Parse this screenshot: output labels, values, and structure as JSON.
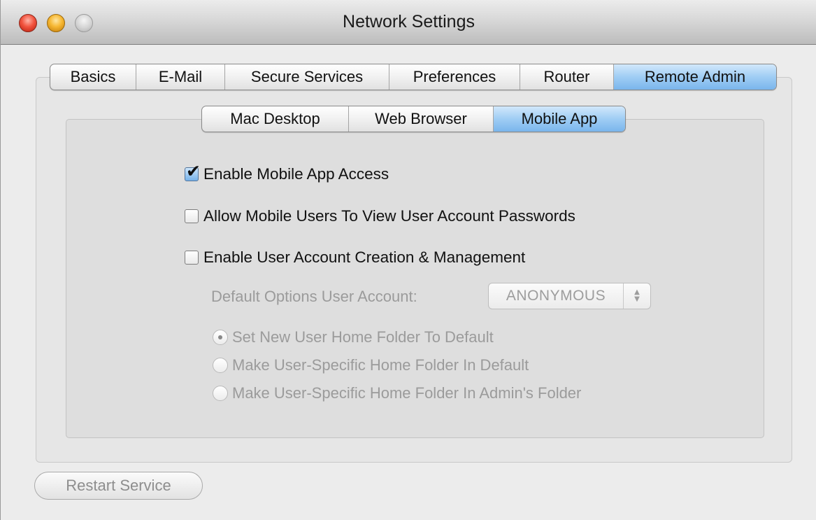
{
  "window": {
    "title": "Network Settings"
  },
  "main_tabs": [
    {
      "label": "Basics",
      "selected": false
    },
    {
      "label": "E-Mail",
      "selected": false
    },
    {
      "label": "Secure Services",
      "selected": false
    },
    {
      "label": "Preferences",
      "selected": false
    },
    {
      "label": "Router",
      "selected": false
    },
    {
      "label": "Remote Admin",
      "selected": true
    }
  ],
  "sub_tabs": [
    {
      "label": "Mac Desktop",
      "selected": false
    },
    {
      "label": "Web Browser",
      "selected": false
    },
    {
      "label": "Mobile App",
      "selected": true
    }
  ],
  "options": {
    "enable_mobile_app_access": {
      "label": "Enable Mobile App Access",
      "checked": true
    },
    "allow_view_passwords": {
      "label": "Allow Mobile Users To View User Account Passwords",
      "checked": false
    },
    "enable_account_management": {
      "label": "Enable User Account Creation & Management",
      "checked": false
    }
  },
  "default_options": {
    "label": "Default Options User Account:",
    "value": "ANONYMOUS",
    "enabled": false
  },
  "home_folder_radios": [
    {
      "label": "Set New User Home Folder To Default",
      "selected": true,
      "enabled": false
    },
    {
      "label": "Make User-Specific Home Folder In Default",
      "selected": false,
      "enabled": false
    },
    {
      "label": "Make User-Specific Home Folder In Admin's Folder",
      "selected": false,
      "enabled": false
    }
  ],
  "footer": {
    "restart_label": "Restart Service",
    "restart_enabled": false
  },
  "colors": {
    "selected_tab": "#9fcdf4",
    "window_bg": "#ececec",
    "disabled_text": "#9b9b9b"
  },
  "icons": {
    "close": "close-traffic-light-icon",
    "minimize": "minimize-traffic-light-icon",
    "zoom": "zoom-traffic-light-icon",
    "checkmark": "checkmark-icon",
    "popup_arrows": "up-down-arrows-icon"
  }
}
